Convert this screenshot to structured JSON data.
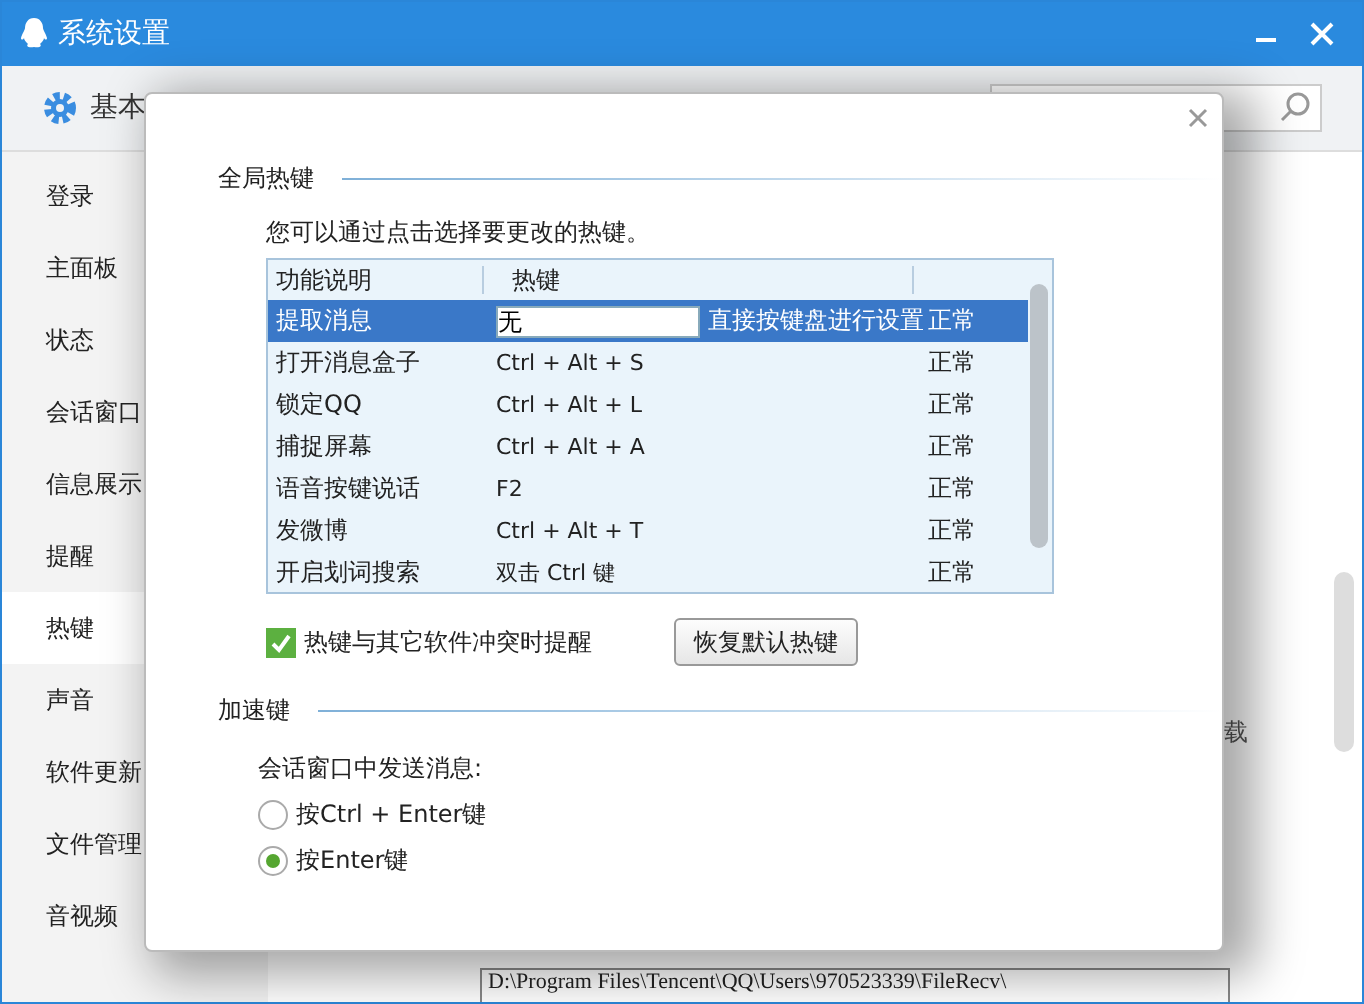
{
  "window": {
    "title": "系统设置"
  },
  "toolbar": {
    "tab": "基本"
  },
  "sidebar": {
    "items": [
      {
        "label": "登录",
        "selected": false
      },
      {
        "label": "主面板",
        "selected": false
      },
      {
        "label": "状态",
        "selected": false
      },
      {
        "label": "会话窗口",
        "selected": false
      },
      {
        "label": "信息展示",
        "selected": false
      },
      {
        "label": "提醒",
        "selected": false
      },
      {
        "label": "热键",
        "selected": true
      },
      {
        "label": "声音",
        "selected": false
      },
      {
        "label": "软件更新",
        "selected": false
      },
      {
        "label": "文件管理",
        "selected": false
      },
      {
        "label": "音视频",
        "selected": false
      }
    ]
  },
  "background": {
    "text": "载",
    "path": "D:\\Program Files\\Tencent\\QQ\\Users\\970523339\\FileRecv\\"
  },
  "dialog": {
    "section_1": "全局热键",
    "hint": "您可以通过点击选择要更改的热键。",
    "table": {
      "columns": [
        "功能说明",
        "热键"
      ],
      "rows": [
        {
          "name": "提取消息",
          "hotkey": "无",
          "note": "直接按键盘进行设置",
          "status": "正常",
          "selected": true
        },
        {
          "name": "打开消息盒子",
          "hotkey": "Ctrl + Alt + S",
          "status": "正常",
          "selected": false
        },
        {
          "name": "锁定QQ",
          "hotkey": "Ctrl + Alt + L",
          "status": "正常",
          "selected": false
        },
        {
          "name": "捕捉屏幕",
          "hotkey": "Ctrl + Alt + A",
          "status": "正常",
          "selected": false
        },
        {
          "name": "语音按键说话",
          "hotkey": "F2",
          "status": "正常",
          "selected": false
        },
        {
          "name": "发微博",
          "hotkey": "Ctrl + Alt + T",
          "status": "正常",
          "selected": false
        },
        {
          "name": "开启划词搜索",
          "hotkey": "双击 Ctrl 键",
          "status": "正常",
          "selected": false
        }
      ]
    },
    "conflict_alert": {
      "label": "热键与其它软件冲突时提醒",
      "checked": true
    },
    "reset_button": "恢复默认热键",
    "section_2": "加速键",
    "send_label": "会话窗口中发送消息:",
    "send_options": [
      {
        "label": "按Ctrl + Enter键",
        "selected": false
      },
      {
        "label": "按Enter键",
        "selected": true
      }
    ]
  }
}
